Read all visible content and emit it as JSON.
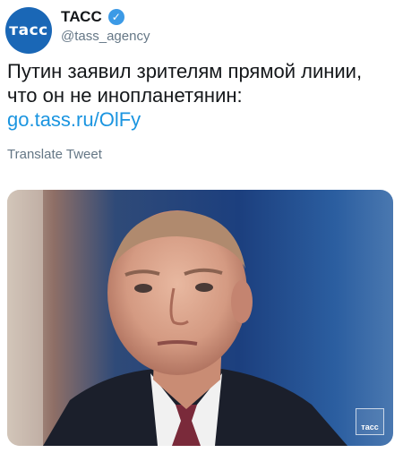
{
  "account": {
    "avatar_text": "тасс",
    "name": "ТАСС",
    "handle": "@tass_agency",
    "verified_icon": "verified-badge-icon",
    "avatar_color": "#1a67b6",
    "verified_color": "#3c9ae6"
  },
  "tweet": {
    "line1": "Путин заявил зрителям прямой линии,",
    "line2": "что он не инопланетянин:",
    "link": "go.tass.ru/OlFy",
    "link_color": "#1b95e0"
  },
  "translate_label": "Translate Tweet",
  "photo": {
    "watermark_text": "тасс"
  }
}
